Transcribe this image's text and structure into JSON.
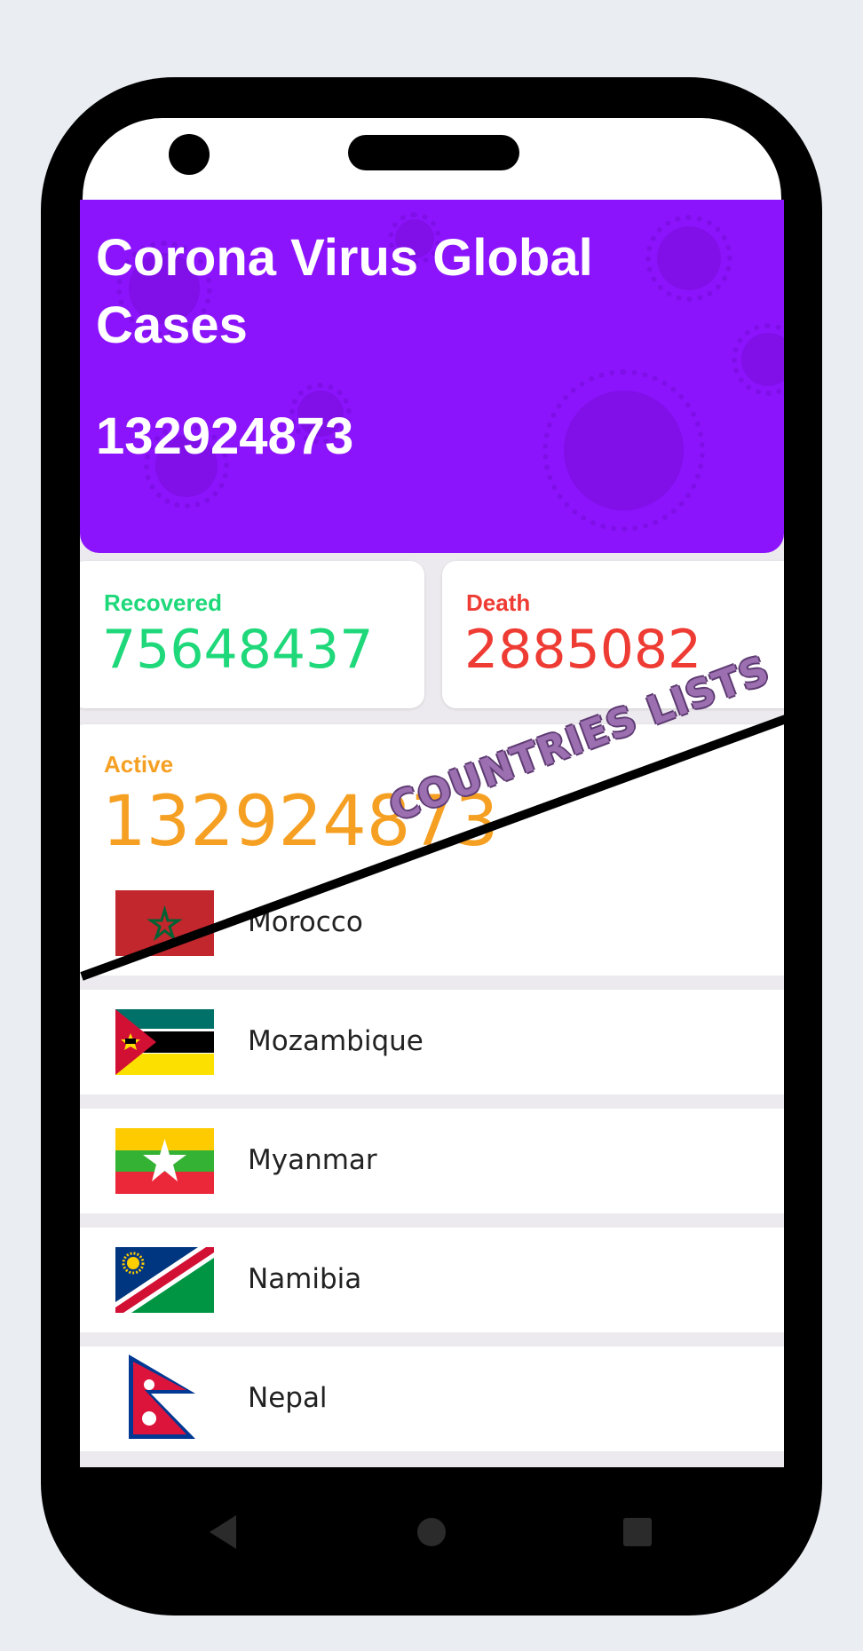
{
  "header": {
    "title": "Corona Virus Global Cases",
    "total": "132924873",
    "color": "#8c14fc"
  },
  "stats": {
    "recovered": {
      "label": "Recovered",
      "value": "75648437",
      "color": "#1ed87a"
    },
    "death": {
      "label": "Death",
      "value": "2885082",
      "color": "#ee3b33"
    },
    "active": {
      "label": "Active",
      "value": "132924873",
      "color": "#f5a023"
    }
  },
  "countries": [
    {
      "name": "Morocco",
      "flag": "morocco-flag-icon"
    },
    {
      "name": "Mozambique",
      "flag": "mozambique-flag-icon"
    },
    {
      "name": "Myanmar",
      "flag": "myanmar-flag-icon"
    },
    {
      "name": "Namibia",
      "flag": "namibia-flag-icon"
    },
    {
      "name": "Nepal",
      "flag": "nepal-flag-icon"
    }
  ],
  "banner": {
    "text": "COUNTRIES LISTS"
  },
  "navbar": {
    "back": "back-triangle-icon",
    "home": "home-circle-icon",
    "recents": "recents-square-icon"
  }
}
